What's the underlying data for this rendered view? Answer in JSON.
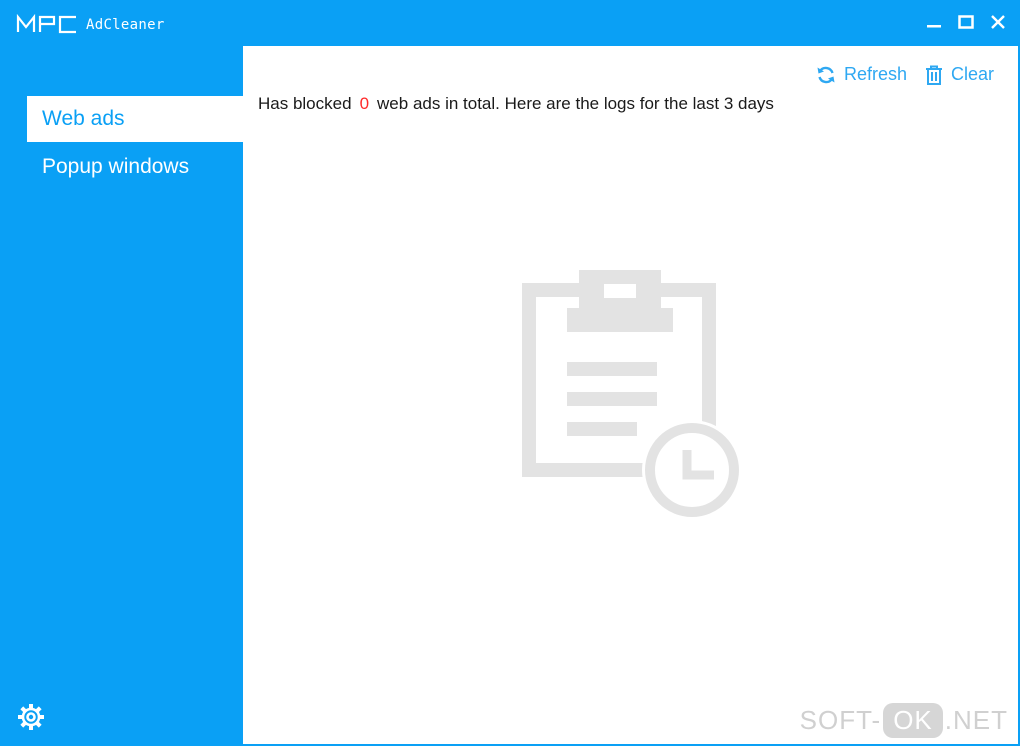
{
  "app": {
    "logo_text": "MPC",
    "name": "AdCleaner"
  },
  "window_controls": {
    "minimize_icon": "minimize-icon",
    "maximize_icon": "maximize-icon",
    "close_icon": "close-icon"
  },
  "sidebar": {
    "items": [
      {
        "label": "Web ads",
        "active": true
      },
      {
        "label": "Popup windows",
        "active": false
      }
    ],
    "settings_icon": "gear-icon"
  },
  "toolbar": {
    "refresh_label": "Refresh",
    "clear_label": "Clear"
  },
  "summary": {
    "prefix": "Has blocked",
    "count": "0",
    "suffix": "web ads in total. Here are the logs for the last 3 days"
  },
  "empty_state": {
    "icon": "clipboard-clock-icon"
  },
  "watermark": {
    "left": "SOFT-",
    "mid": "OK",
    "right": ".NET"
  },
  "colors": {
    "accent": "#0aa0f5",
    "count": "#ff2a2a",
    "illustration": "#e3e3e3"
  }
}
